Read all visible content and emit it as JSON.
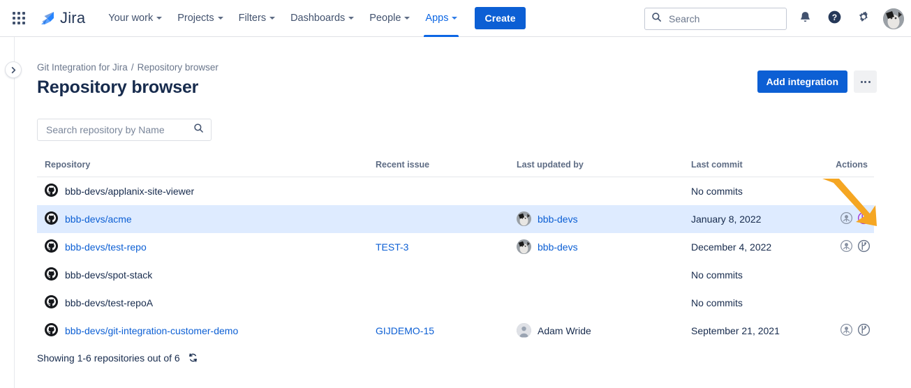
{
  "topnav": {
    "app_switcher": "app-switcher",
    "product_name": "Jira",
    "items": [
      {
        "label": "Your work",
        "has_caret": true,
        "active": false
      },
      {
        "label": "Projects",
        "has_caret": true,
        "active": false
      },
      {
        "label": "Filters",
        "has_caret": true,
        "active": false
      },
      {
        "label": "Dashboards",
        "has_caret": true,
        "active": false
      },
      {
        "label": "People",
        "has_caret": true,
        "active": false
      },
      {
        "label": "Apps",
        "has_caret": true,
        "active": true
      }
    ],
    "create_label": "Create",
    "search": {
      "placeholder": "Search",
      "value": ""
    },
    "icons": {
      "notifications": "notification-bell-icon",
      "help": "help-icon",
      "settings": "gear-icon",
      "profile": "profile-avatar"
    }
  },
  "sidebar": {
    "expand_label": "expand-sidebar"
  },
  "header": {
    "breadcrumb": {
      "parent": "Git Integration for Jira",
      "separator": "/",
      "current": "Repository browser"
    },
    "title": "Repository browser",
    "add_integration_label": "Add integration",
    "more_label": "more-actions"
  },
  "filter": {
    "search_placeholder": "Search repository by Name",
    "search_value": ""
  },
  "table": {
    "columns": [
      "Repository",
      "Recent issue",
      "Last updated by",
      "Last commit",
      "Actions"
    ],
    "rows": [
      {
        "repository": "bbb-devs/applanix-site-viewer",
        "repository_is_link": false,
        "recent_issue": "",
        "updated_by": "",
        "updated_by_is_link": false,
        "avatar_type": "none",
        "last_commit": "No commits",
        "selected": false,
        "has_actions": false
      },
      {
        "repository": "bbb-devs/acme",
        "repository_is_link": true,
        "recent_issue": "",
        "updated_by": "bbb-devs",
        "updated_by_is_link": true,
        "avatar_type": "cat",
        "last_commit": "January 8, 2022",
        "selected": true,
        "has_actions": true
      },
      {
        "repository": "bbb-devs/test-repo",
        "repository_is_link": true,
        "recent_issue": "TEST-3",
        "updated_by": "bbb-devs",
        "updated_by_is_link": true,
        "avatar_type": "cat",
        "last_commit": "December 4, 2022",
        "selected": false,
        "has_actions": true
      },
      {
        "repository": "bbb-devs/spot-stack",
        "repository_is_link": false,
        "recent_issue": "",
        "updated_by": "",
        "updated_by_is_link": false,
        "avatar_type": "none",
        "last_commit": "No commits",
        "selected": false,
        "has_actions": false
      },
      {
        "repository": "bbb-devs/test-repoA",
        "repository_is_link": false,
        "recent_issue": "",
        "updated_by": "",
        "updated_by_is_link": false,
        "avatar_type": "none",
        "last_commit": "No commits",
        "selected": false,
        "has_actions": false
      },
      {
        "repository": "bbb-devs/git-integration-customer-demo",
        "repository_is_link": true,
        "recent_issue": "GIJDEMO-15",
        "updated_by": "Adam Wride",
        "updated_by_is_link": false,
        "avatar_type": "generic",
        "last_commit": "September 21, 2021",
        "selected": false,
        "has_actions": true
      }
    ],
    "action_icons": [
      "git-commits-icon",
      "git-branches-icon"
    ]
  },
  "footer": {
    "summary": "Showing 1-6 repositories out of 6",
    "refresh_label": "refresh-icon"
  },
  "annotation": {
    "arrow": "orange-arrow-pointing-to-actions"
  },
  "colors": {
    "brand_blue": "#0c5fd4",
    "link_blue": "#0c5fd4",
    "selected_row": "#deebff",
    "text_dark": "#172b4d",
    "text_muted": "#5e6c84",
    "annotation_orange": "#f5a623",
    "action_highlight_purple": "#a033d8"
  }
}
